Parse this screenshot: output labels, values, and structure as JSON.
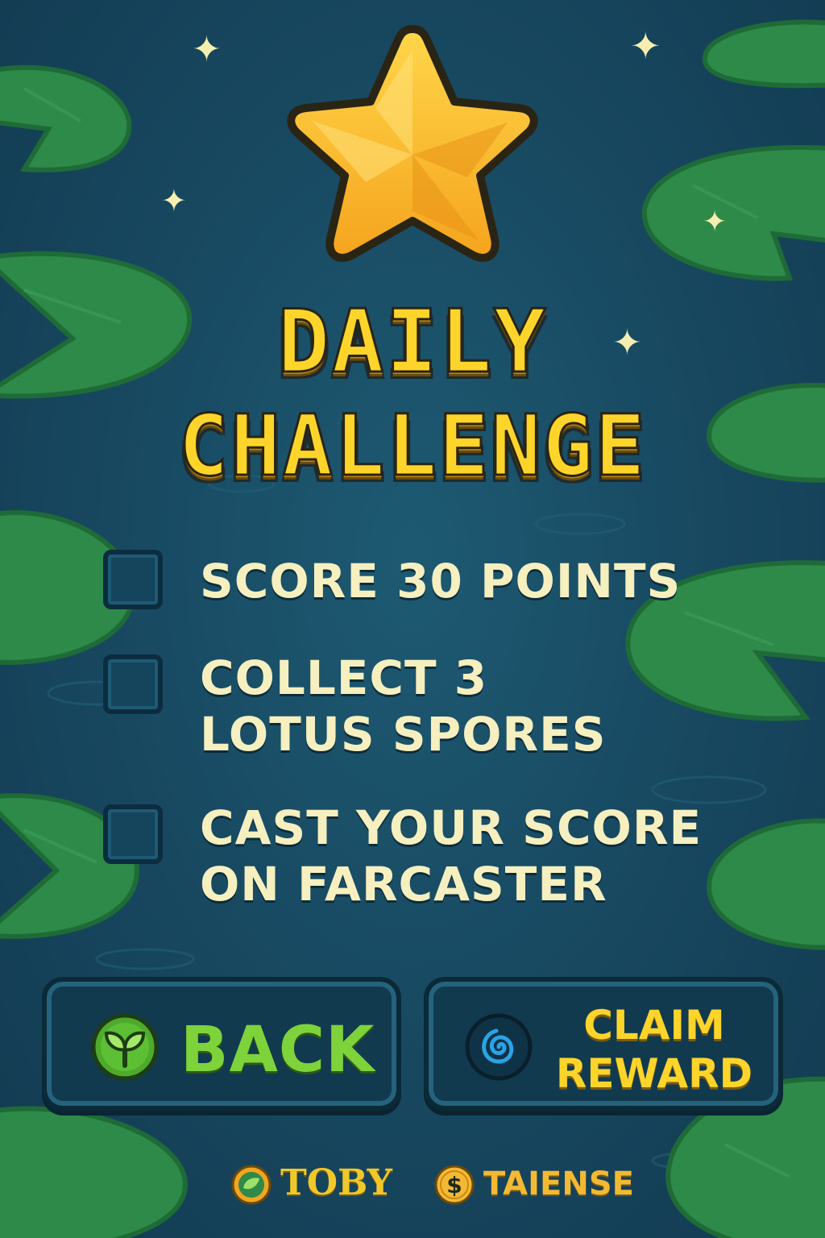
{
  "title": {
    "line1": "DAILY",
    "line2": "CHALLENGE"
  },
  "tasks": [
    {
      "label": "SCORE 30 POINTS",
      "checked": false
    },
    {
      "label": "COLLECT 3\nLOTUS SPORES",
      "checked": false
    },
    {
      "label": "CAST YOUR SCORE\nON FARCASTER",
      "checked": false
    }
  ],
  "buttons": {
    "back": {
      "label": "BACK",
      "icon": "sprout-icon"
    },
    "claim": {
      "line1": "CLAIM",
      "line2": "REWARD",
      "icon": "swirl-icon"
    }
  },
  "footer": {
    "brand1": {
      "name": "TOBY",
      "icon": "leaf-badge-icon"
    },
    "brand2": {
      "name": "TAIENSE",
      "icon": "dollar-coin-icon"
    }
  },
  "colors": {
    "background": "#17475f",
    "title": "#fdd52a",
    "task_text": "#f6efbf",
    "back_label": "#7ed23a",
    "claim_label": "#fdd52a",
    "lily_pad": "#2f8a4a"
  }
}
